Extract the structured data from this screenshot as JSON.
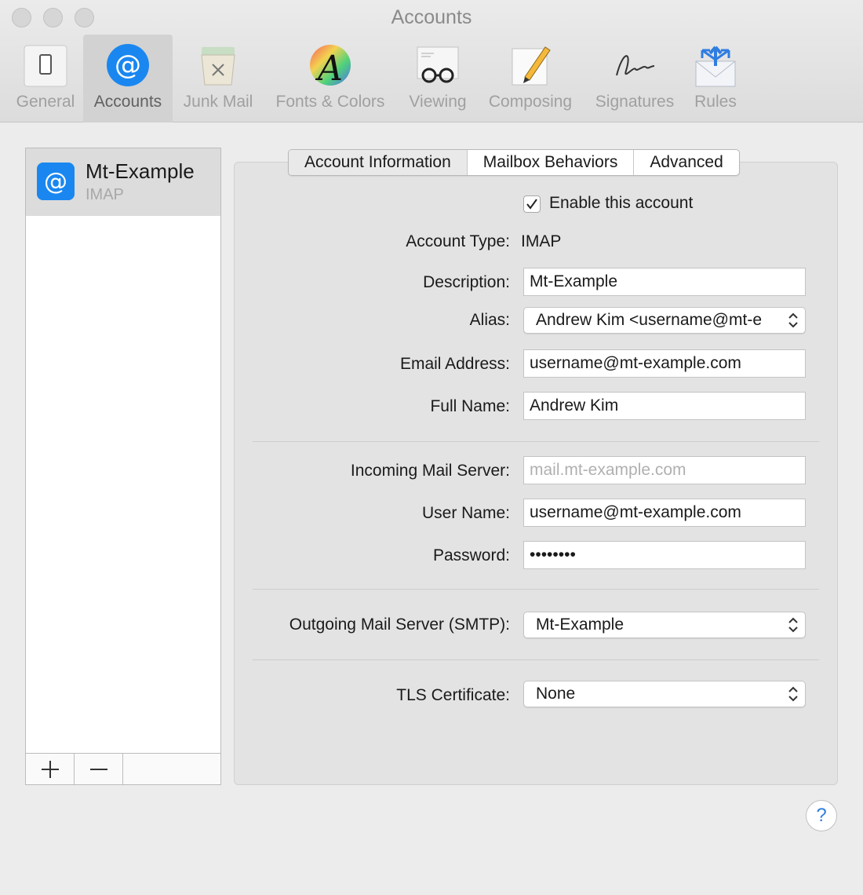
{
  "window": {
    "title": "Accounts"
  },
  "toolbar": {
    "items": [
      {
        "label": "General",
        "icon": "switch-icon"
      },
      {
        "label": "Accounts",
        "icon": "at-sign-icon",
        "active": true
      },
      {
        "label": "Junk Mail",
        "icon": "trash-basket-icon"
      },
      {
        "label": "Fonts & Colors",
        "icon": "font-color-wheel-icon"
      },
      {
        "label": "Viewing",
        "icon": "glasses-icon"
      },
      {
        "label": "Composing",
        "icon": "pencil-paper-icon"
      },
      {
        "label": "Signatures",
        "icon": "signature-icon"
      },
      {
        "label": "Rules",
        "icon": "envelope-arrows-icon"
      }
    ]
  },
  "accounts": {
    "items": [
      {
        "name": "Mt-Example",
        "type": "IMAP",
        "icon": "at-sign-icon"
      }
    ],
    "footer": {
      "add": "+",
      "remove": "—"
    }
  },
  "tabs": [
    {
      "label": "Account Information",
      "selected": true
    },
    {
      "label": "Mailbox Behaviors"
    },
    {
      "label": "Advanced"
    }
  ],
  "form": {
    "enable_label": "Enable this account",
    "enable_checked": true,
    "account_type_label": "Account Type:",
    "account_type_value": "IMAP",
    "description_label": "Description:",
    "description_value": "Mt-Example",
    "alias_label": "Alias:",
    "alias_value": "Andrew Kim <username@mt-e",
    "email_label": "Email Address:",
    "email_value": "username@mt-example.com",
    "fullname_label": "Full Name:",
    "fullname_value": "Andrew Kim",
    "incoming_label": "Incoming Mail Server:",
    "incoming_value": "mail.mt-example.com",
    "username_label": "User Name:",
    "username_value": "username@mt-example.com",
    "password_label": "Password:",
    "password_value": "••••••••",
    "smtp_label": "Outgoing Mail Server (SMTP):",
    "smtp_value": "Mt-Example",
    "tls_label": "TLS Certificate:",
    "tls_value": "None"
  },
  "help": {
    "label": "?"
  },
  "colors": {
    "accent": "#1a87f0",
    "panel": "#e3e3e3",
    "window": "#ececec"
  }
}
